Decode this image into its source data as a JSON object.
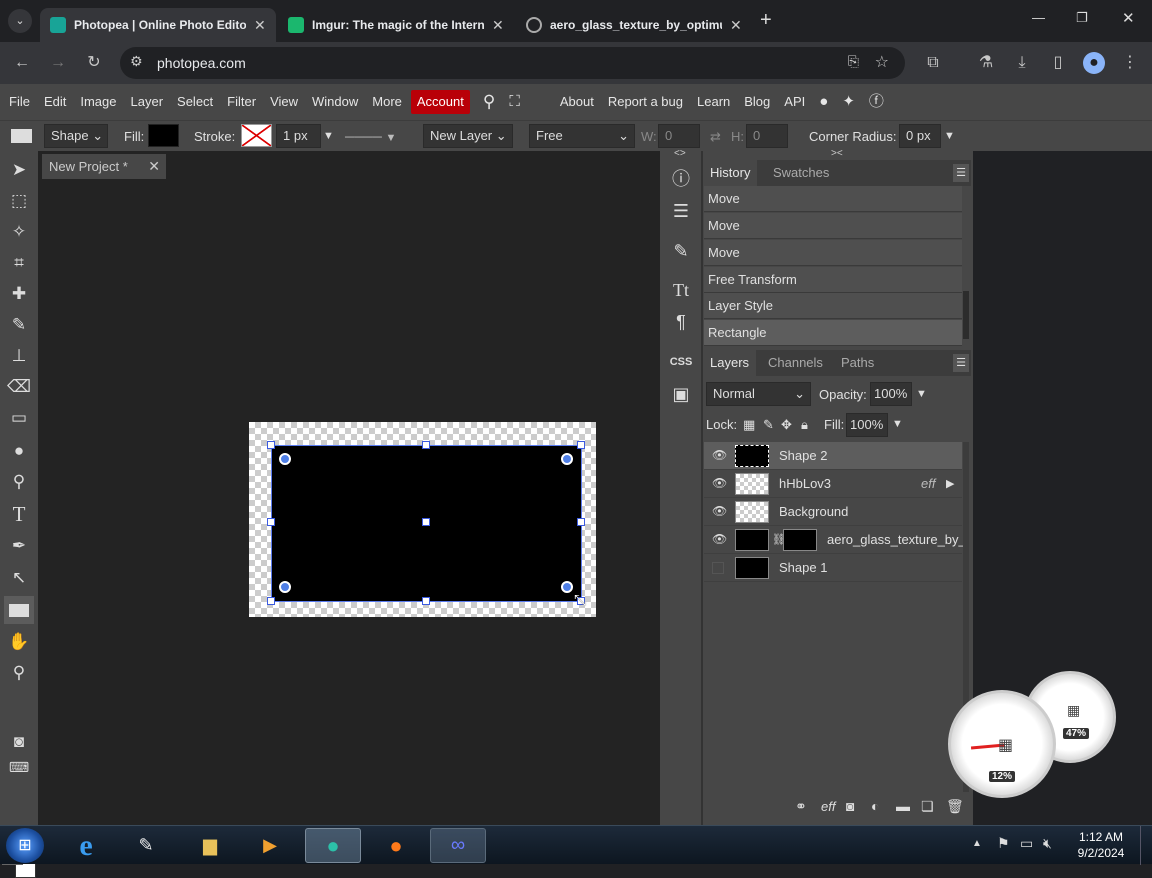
{
  "browser": {
    "tabs": [
      {
        "title": "Photopea | Online Photo Editor",
        "active": true
      },
      {
        "title": "Imgur: The magic of the Internet",
        "active": false
      },
      {
        "title": "aero_glass_texture_by_optimum",
        "active": false
      }
    ],
    "url": "photopea.com"
  },
  "menu": {
    "items": [
      "File",
      "Edit",
      "Image",
      "Layer",
      "Select",
      "Filter",
      "View",
      "Window",
      "More"
    ],
    "account": "Account",
    "right": [
      "About",
      "Report a bug",
      "Learn",
      "Blog",
      "API"
    ]
  },
  "options": {
    "mode": "Shape",
    "fill_label": "Fill:",
    "stroke_label": "Stroke:",
    "stroke_width": "1 px",
    "new_layer": "New Layer",
    "constraint": "Free",
    "w_label": "W:",
    "w_value": "0",
    "h_label": "H:",
    "h_value": "0",
    "corner_label": "Corner Radius:",
    "corner_value": "0 px"
  },
  "document": {
    "tab": "New Project",
    "modified": "*"
  },
  "history": {
    "tabs": [
      "History",
      "Swatches"
    ],
    "items": [
      "Move",
      "Move",
      "Move",
      "Free Transform",
      "Layer Style",
      "Rectangle"
    ]
  },
  "layers": {
    "tabs": [
      "Layers",
      "Channels",
      "Paths"
    ],
    "blend": "Normal",
    "opacity_label": "Opacity:",
    "opacity": "100%",
    "lock_label": "Lock:",
    "fill_label": "Fill:",
    "fill": "100%",
    "items": [
      {
        "name": "Shape 2",
        "fx": ""
      },
      {
        "name": "hHbLov3",
        "fx": "eff"
      },
      {
        "name": "Background",
        "fx": ""
      },
      {
        "name": "aero_glass_texture_by_",
        "fx": ""
      },
      {
        "name": "Shape 1",
        "fx": ""
      }
    ],
    "footer_fx": "eff"
  },
  "gadget": {
    "cpu": "12%",
    "mem": "47%"
  },
  "clock": {
    "time": "1:12 AM",
    "date": "9/2/2024"
  },
  "colors": {
    "accent": "#b90008",
    "selection": "#4f7fe6"
  }
}
